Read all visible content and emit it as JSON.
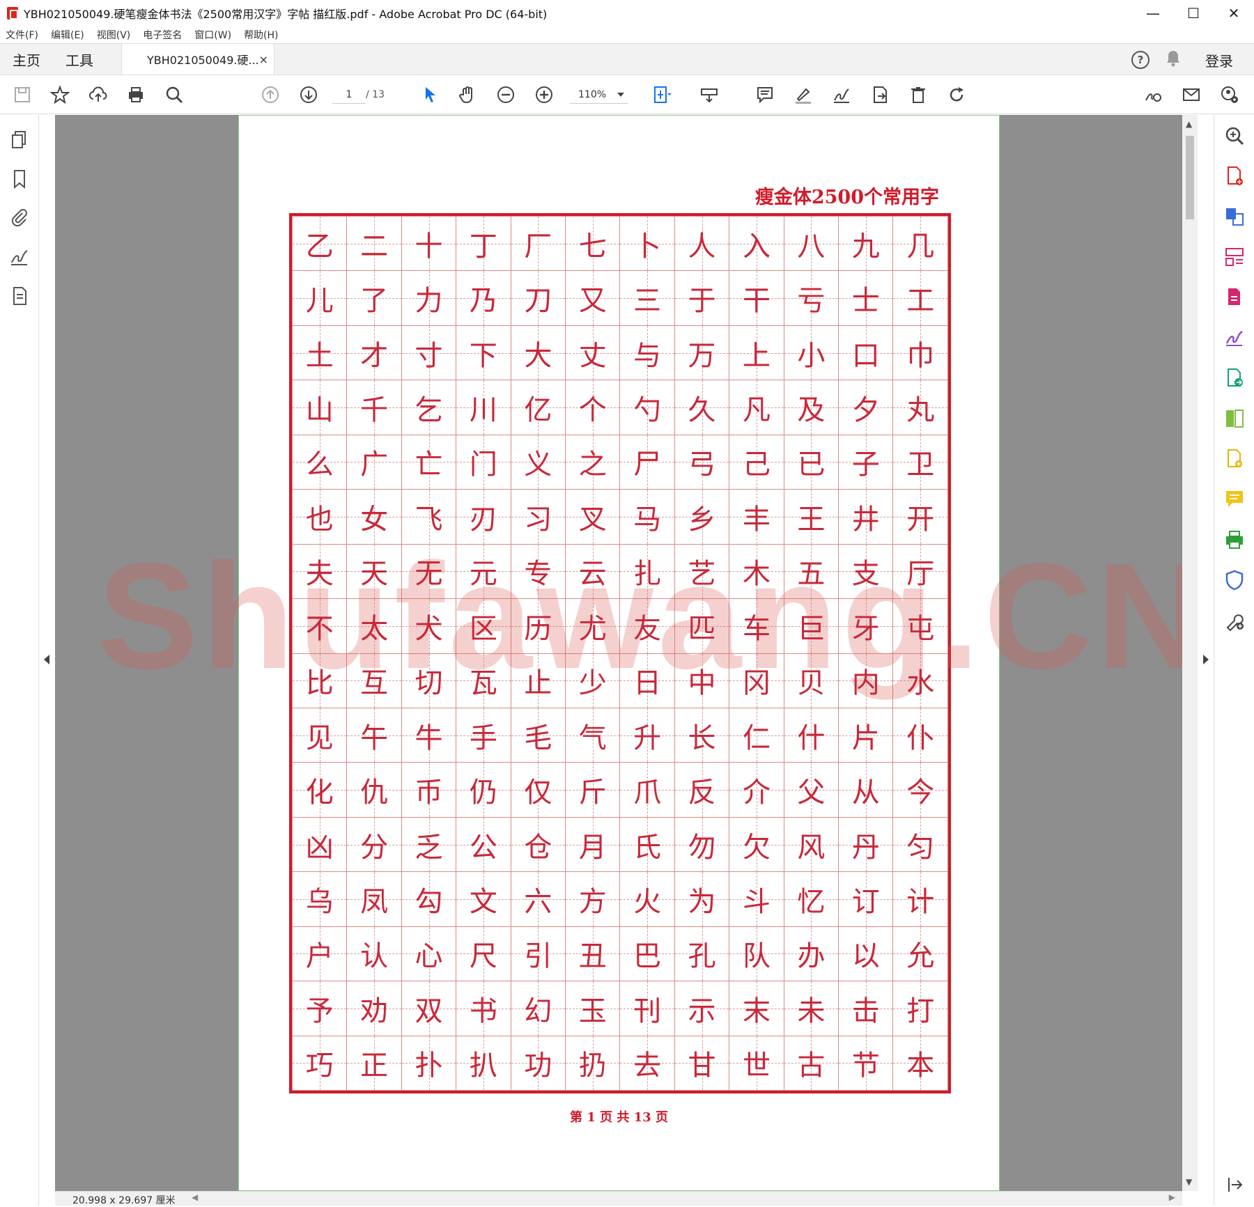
{
  "window": {
    "title": "YBH021050049.硬笔瘦金体书法《2500常用汉字》字帖 描红版.pdf - Adobe Acrobat Pro DC (64-bit)",
    "minimize": "—",
    "maximize": "☐",
    "close": "✕"
  },
  "menu": [
    "文件(F)",
    "编辑(E)",
    "视图(V)",
    "电子签名",
    "窗口(W)",
    "帮助(H)"
  ],
  "tabs": {
    "home": "主页",
    "tools": "工具",
    "document": "YBH021050049.硬...",
    "close": "×",
    "login": "登录",
    "help": "?"
  },
  "toolbar": {
    "page_current": "1",
    "page_total": "/ 13",
    "zoom": "110%"
  },
  "page": {
    "header": "瘦金体2500个常用字",
    "footer": "第 1 页 共 13 页",
    "grid": [
      [
        "乙",
        "二",
        "十",
        "丁",
        "厂",
        "七",
        "卜",
        "人",
        "入",
        "八",
        "九",
        "几"
      ],
      [
        "儿",
        "了",
        "力",
        "乃",
        "刀",
        "又",
        "三",
        "于",
        "干",
        "亏",
        "士",
        "工"
      ],
      [
        "土",
        "才",
        "寸",
        "下",
        "大",
        "丈",
        "与",
        "万",
        "上",
        "小",
        "口",
        "巾"
      ],
      [
        "山",
        "千",
        "乞",
        "川",
        "亿",
        "个",
        "勺",
        "久",
        "凡",
        "及",
        "夕",
        "丸"
      ],
      [
        "么",
        "广",
        "亡",
        "门",
        "义",
        "之",
        "尸",
        "弓",
        "己",
        "已",
        "子",
        "卫"
      ],
      [
        "也",
        "女",
        "飞",
        "刃",
        "习",
        "叉",
        "马",
        "乡",
        "丰",
        "王",
        "井",
        "开"
      ],
      [
        "夫",
        "天",
        "无",
        "元",
        "专",
        "云",
        "扎",
        "艺",
        "木",
        "五",
        "支",
        "厅"
      ],
      [
        "不",
        "太",
        "犬",
        "区",
        "历",
        "尤",
        "友",
        "匹",
        "车",
        "巨",
        "牙",
        "屯"
      ],
      [
        "比",
        "互",
        "切",
        "瓦",
        "止",
        "少",
        "日",
        "中",
        "冈",
        "贝",
        "内",
        "水"
      ],
      [
        "见",
        "午",
        "牛",
        "手",
        "毛",
        "气",
        "升",
        "长",
        "仁",
        "什",
        "片",
        "仆"
      ],
      [
        "化",
        "仇",
        "币",
        "仍",
        "仅",
        "斤",
        "爪",
        "反",
        "介",
        "父",
        "从",
        "今"
      ],
      [
        "凶",
        "分",
        "乏",
        "公",
        "仓",
        "月",
        "氏",
        "勿",
        "欠",
        "风",
        "丹",
        "匀"
      ],
      [
        "乌",
        "凤",
        "勾",
        "文",
        "六",
        "方",
        "火",
        "为",
        "斗",
        "忆",
        "订",
        "计"
      ],
      [
        "户",
        "认",
        "心",
        "尺",
        "引",
        "丑",
        "巴",
        "孔",
        "队",
        "办",
        "以",
        "允"
      ],
      [
        "予",
        "劝",
        "双",
        "书",
        "幻",
        "玉",
        "刊",
        "示",
        "末",
        "未",
        "击",
        "打"
      ],
      [
        "巧",
        "正",
        "扑",
        "扒",
        "功",
        "扔",
        "去",
        "甘",
        "世",
        "古",
        "节",
        "本"
      ]
    ]
  },
  "watermark": "Shufawang.CN",
  "status": {
    "page_size": "20.998 x 29.697 厘米"
  }
}
